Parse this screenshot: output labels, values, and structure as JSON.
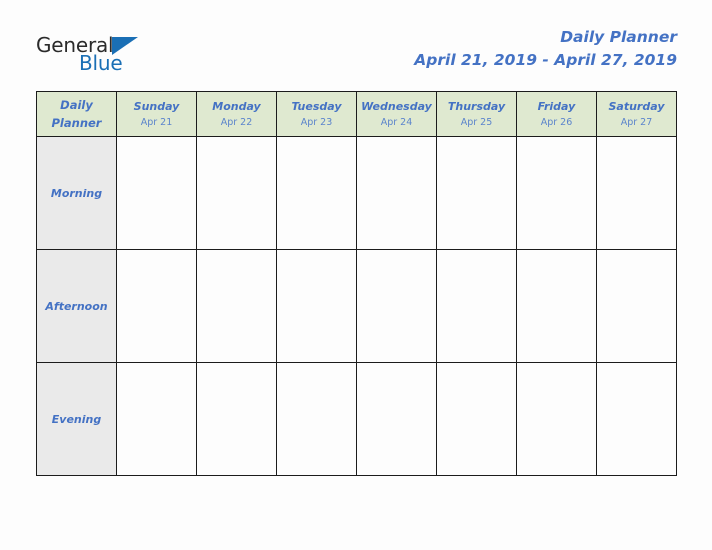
{
  "brand": {
    "name_part1": "General",
    "name_part2": "Blue",
    "triangle_icon": "triangle-icon",
    "accent_color": "#1a6fb5"
  },
  "header": {
    "title": "Daily Planner",
    "date_range": "April 21, 2019 - April 27, 2019",
    "title_color": "#4472c4"
  },
  "table": {
    "corner_label": "Daily Planner",
    "header_bg": "#dfe9d0",
    "row_label_bg": "#eaeaea",
    "cell_bg": "#fdfdfd",
    "border_color": "#1c1c1c",
    "columns": [
      {
        "day": "Sunday",
        "date": "Apr 21"
      },
      {
        "day": "Monday",
        "date": "Apr 22"
      },
      {
        "day": "Tuesday",
        "date": "Apr 23"
      },
      {
        "day": "Wednesday",
        "date": "Apr 24"
      },
      {
        "day": "Thursday",
        "date": "Apr 25"
      },
      {
        "day": "Friday",
        "date": "Apr 26"
      },
      {
        "day": "Saturday",
        "date": "Apr 27"
      }
    ],
    "rows": [
      {
        "label": "Morning",
        "entries": [
          "",
          "",
          "",
          "",
          "",
          "",
          ""
        ]
      },
      {
        "label": "Afternoon",
        "entries": [
          "",
          "",
          "",
          "",
          "",
          "",
          ""
        ]
      },
      {
        "label": "Evening",
        "entries": [
          "",
          "",
          "",
          "",
          "",
          "",
          ""
        ]
      }
    ]
  }
}
